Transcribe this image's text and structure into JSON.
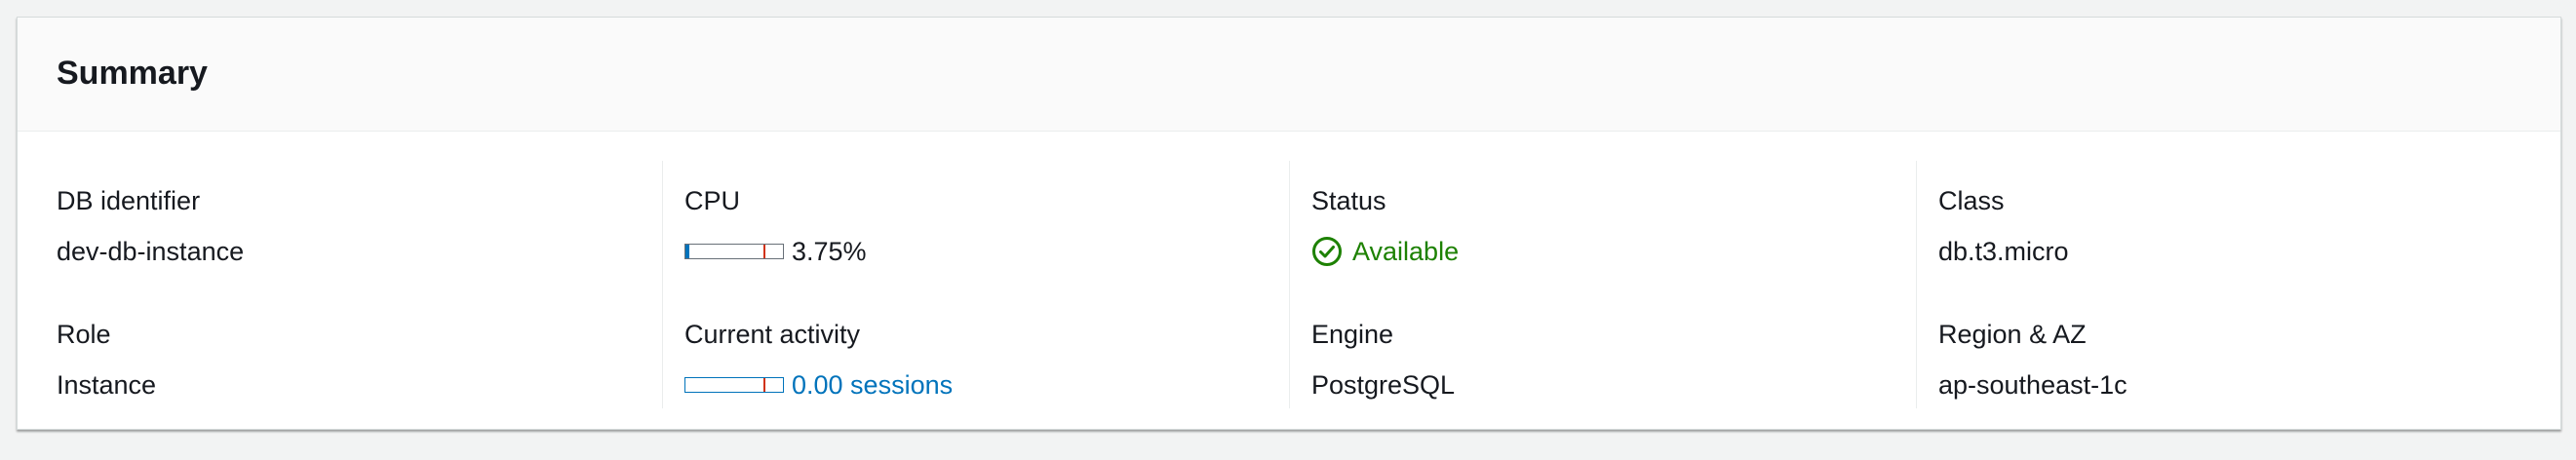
{
  "summary": {
    "title": "Summary",
    "db_identifier": {
      "label": "DB identifier",
      "value": "dev-db-instance"
    },
    "role": {
      "label": "Role",
      "value": "Instance"
    },
    "cpu": {
      "label": "CPU",
      "value": "3.75%",
      "percent": 3.75,
      "threshold_percent": 80
    },
    "current_activity": {
      "label": "Current activity",
      "value": "0.00 sessions",
      "fraction": 0.0,
      "threshold_fraction": 0.8
    },
    "status": {
      "label": "Status",
      "value": "Available",
      "icon": "check-circle-icon"
    },
    "engine": {
      "label": "Engine",
      "value": "PostgreSQL"
    },
    "class": {
      "label": "Class",
      "value": "db.t3.micro"
    },
    "region_az": {
      "label": "Region & AZ",
      "value": "ap-southeast-1c"
    }
  },
  "colors": {
    "link": "#0073bb",
    "success": "#1d8102",
    "threshold": "#d13212"
  }
}
